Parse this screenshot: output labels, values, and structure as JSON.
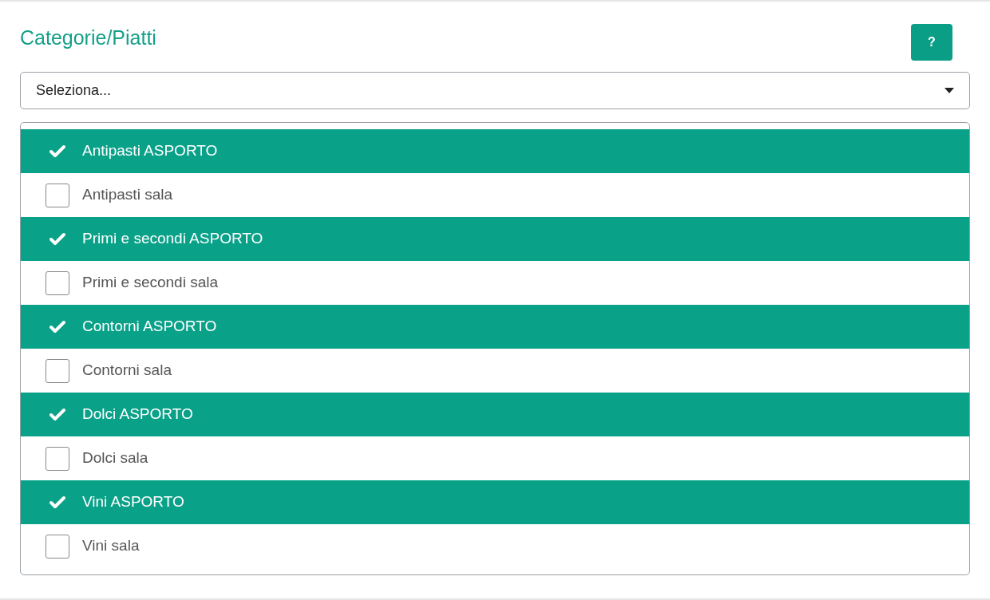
{
  "title": "Categorie/Piatti",
  "help_button": {
    "label": "?"
  },
  "select": {
    "placeholder": "Seleziona..."
  },
  "options": [
    {
      "label": "Antipasti ASPORTO",
      "selected": true
    },
    {
      "label": "Antipasti sala",
      "selected": false
    },
    {
      "label": "Primi e secondi ASPORTO",
      "selected": true
    },
    {
      "label": "Primi e secondi sala",
      "selected": false
    },
    {
      "label": "Contorni ASPORTO",
      "selected": true
    },
    {
      "label": "Contorni sala",
      "selected": false
    },
    {
      "label": "Dolci ASPORTO",
      "selected": true
    },
    {
      "label": "Dolci sala",
      "selected": false
    },
    {
      "label": "Vini ASPORTO",
      "selected": true
    },
    {
      "label": "Vini sala",
      "selected": false
    }
  ]
}
